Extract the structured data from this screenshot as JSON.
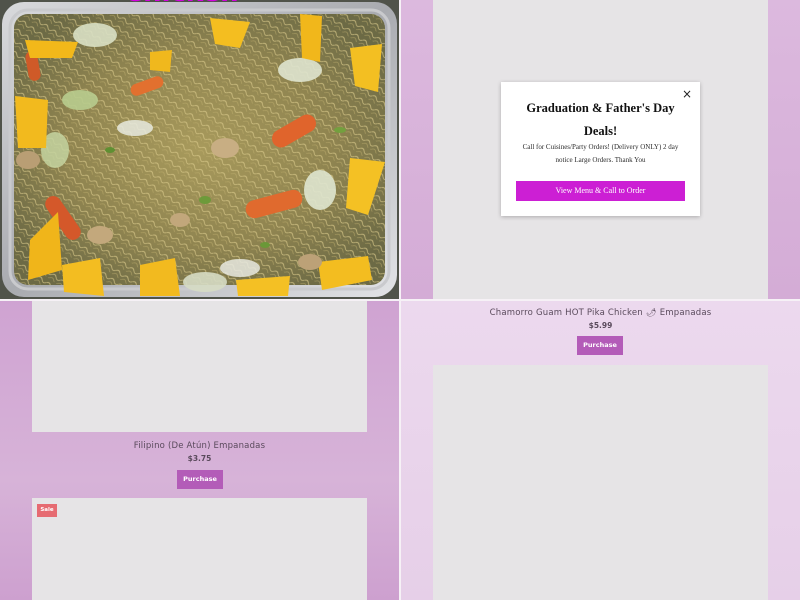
{
  "colors": {
    "accent_magenta": "#cc1fd4",
    "purchase_button": "#b35cb8",
    "sale_badge": "#e66b72",
    "placeholder_gray": "#e6e4e6",
    "background_lilac": "#d4acd6"
  },
  "hero": {
    "title": "Chicken",
    "image": "pancit-noodles-tray-photo"
  },
  "popup": {
    "close_icon": "×",
    "title": "Graduation & Father's Day Deals!",
    "body": "Call for Cuisines/Party Orders! (Delivery ONLY) 2 day notice Large Orders. Thank You",
    "cta_label": "View Menu & Call to Order"
  },
  "products": [
    {
      "title": "Filipino (De Atún) Empanadas",
      "price": "$3.75",
      "purchase_label": "Purchase"
    },
    {
      "title": "Chamorro Guam HOT Pika Chicken 🌶 Empanadas",
      "price": "$5.99",
      "purchase_label": "Purchase"
    }
  ],
  "sale_badge_label": "Sale"
}
